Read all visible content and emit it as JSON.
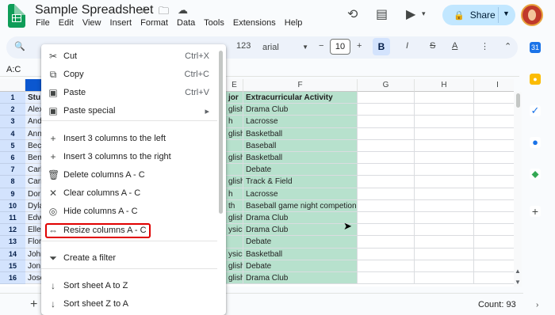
{
  "app": {
    "doc_title": "Sample Spreadsheet",
    "menus": [
      "File",
      "Edit",
      "View",
      "Insert",
      "Format",
      "Data",
      "Tools",
      "Extensions",
      "Help"
    ],
    "share_label": "Share"
  },
  "toolbar": {
    "number_format": "123",
    "font": "arial",
    "font_size": "10",
    "bold": "B",
    "text_color": "A"
  },
  "namebox": "A:C",
  "columns": [
    {
      "label": "",
      "sel": true
    },
    {
      "label": "E",
      "sel": false
    },
    {
      "label": "F",
      "sel": false
    },
    {
      "label": "G",
      "sel": false
    },
    {
      "label": "H",
      "sel": false
    },
    {
      "label": "I",
      "sel": false
    }
  ],
  "rows": [
    {
      "num": "1",
      "a": "Stu",
      "e": "jor",
      "f": "Extracurricular Activity"
    },
    {
      "num": "2",
      "a": "Alex",
      "e": "glish",
      "f": "Drama Club"
    },
    {
      "num": "3",
      "a": "And",
      "e": "h",
      "f": "Lacrosse"
    },
    {
      "num": "4",
      "a": "Ann",
      "e": "glish",
      "f": "Basketball"
    },
    {
      "num": "5",
      "a": "Bec",
      "e": "",
      "f": "Baseball"
    },
    {
      "num": "6",
      "a": "Ben",
      "e": "glish",
      "f": "Basketball"
    },
    {
      "num": "7",
      "a": "Carl",
      "e": "",
      "f": "Debate"
    },
    {
      "num": "8",
      "a": "Carr",
      "e": "glish",
      "f": "Track & Field"
    },
    {
      "num": "9",
      "a": "Dor",
      "e": "h",
      "f": "Lacrosse"
    },
    {
      "num": "10",
      "a": "Dyla",
      "e": "th",
      "f": "Baseball game night competion"
    },
    {
      "num": "11",
      "a": "Edw",
      "e": "glish",
      "f": "Drama Club"
    },
    {
      "num": "12",
      "a": "Elle",
      "e": "ysics",
      "f": "Drama Club"
    },
    {
      "num": "13",
      "a": "Flor",
      "e": "",
      "f": "Debate"
    },
    {
      "num": "14",
      "a": "John",
      "e": "ysics",
      "f": "Basketball"
    },
    {
      "num": "15",
      "a": "Jon",
      "e": "glish",
      "f": "Debate"
    },
    {
      "num": "16",
      "a": "Jose",
      "e": "glish",
      "f": "Drama Club"
    }
  ],
  "context_menu": {
    "items": [
      {
        "icon": "✂",
        "label": "Cut",
        "shortcut": "Ctrl+X"
      },
      {
        "icon": "⧉",
        "label": "Copy",
        "shortcut": "Ctrl+C"
      },
      {
        "icon": "▣",
        "label": "Paste",
        "shortcut": "Ctrl+V"
      },
      {
        "icon": "▣",
        "label": "Paste special",
        "shortcut": "▸"
      },
      {
        "icon": "+",
        "label": "Insert 3 columns to the left",
        "shortcut": ""
      },
      {
        "icon": "+",
        "label": "Insert 3 columns to the right",
        "shortcut": ""
      },
      {
        "icon": "🗑",
        "label": "Delete columns A - C",
        "shortcut": ""
      },
      {
        "icon": "✕",
        "label": "Clear columns A - C",
        "shortcut": ""
      },
      {
        "icon": "◎",
        "label": "Hide columns A - C",
        "shortcut": ""
      },
      {
        "icon": "⇔",
        "label": "Resize columns A - C",
        "shortcut": ""
      },
      {
        "icon": "⏷",
        "label": "Create a filter",
        "shortcut": ""
      },
      {
        "icon": "↓",
        "label": "Sort sheet A to Z",
        "shortcut": ""
      },
      {
        "icon": "↓",
        "label": "Sort sheet Z to A",
        "shortcut": ""
      }
    ]
  },
  "status": {
    "count": "Count: 93"
  }
}
